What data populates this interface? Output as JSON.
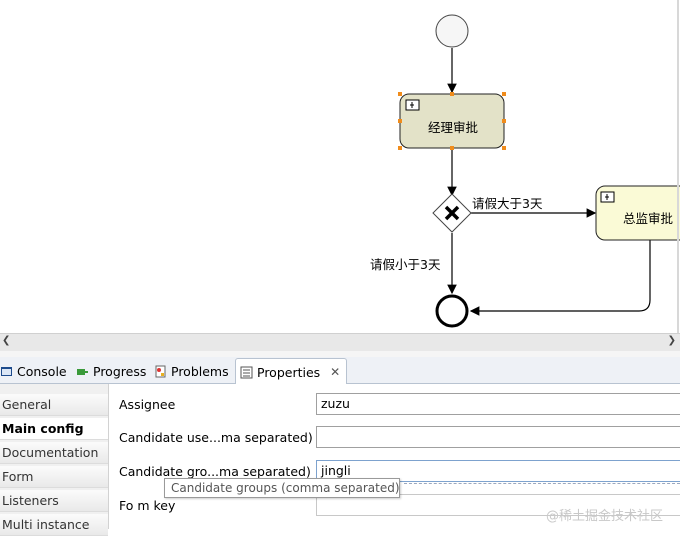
{
  "diagram": {
    "tasks": [
      {
        "label": "经理审批"
      },
      {
        "label": "总监审批"
      }
    ],
    "flows": [
      {
        "label": "请假大于3天"
      },
      {
        "label": "请假小于3天"
      }
    ],
    "colors": {
      "task_fill": "#e3e2c8",
      "task2_fill": "#fafad6",
      "selection_handle": "#f08c1c"
    }
  },
  "tabs": [
    {
      "label": "Console",
      "icon": "console-icon"
    },
    {
      "label": "Progress",
      "icon": "progress-icon"
    },
    {
      "label": "Problems",
      "icon": "problems-icon"
    },
    {
      "label": "Properties",
      "icon": "properties-icon",
      "active": true
    }
  ],
  "nav": {
    "items": [
      "General",
      "Main config",
      "Documentation",
      "Form",
      "Listeners",
      "Multi instance"
    ],
    "active": "Main config"
  },
  "properties": {
    "assignee_label": "Assignee",
    "assignee_value": "zuzu",
    "candidate_users_label": "Candidate use...ma separated)",
    "candidate_users_value": "",
    "candidate_groups_label": "Candidate gro...ma separated)",
    "candidate_groups_value": "jingli",
    "form_key_label": "Fo m key"
  },
  "tooltip": "Candidate groups (comma separated)",
  "watermark": "@稀土掘金技术社区"
}
